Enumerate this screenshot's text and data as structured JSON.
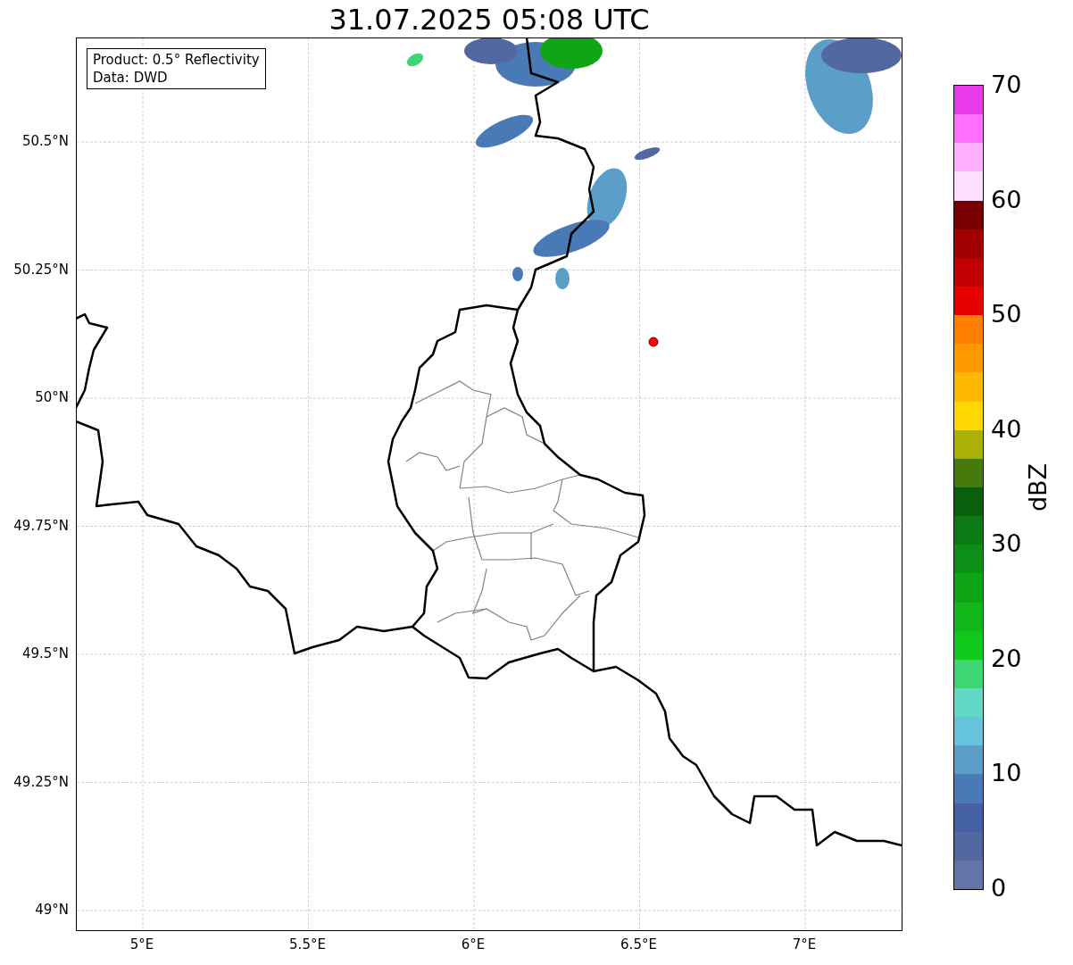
{
  "title": "31.07.2025 05:08 UTC",
  "info_box": {
    "lines": [
      "Product: 0.5° Reflectivity",
      "Data: DWD"
    ]
  },
  "map": {
    "yticks": [
      "50.5°N",
      "50.25°N",
      "50°N",
      "49.75°N",
      "49.5°N",
      "49.25°N",
      "49°N"
    ],
    "xticks": [
      "5°E",
      "5.5°E",
      "6°E",
      "6.5°E",
      "7°E"
    ]
  },
  "colorbar": {
    "label": "dBZ",
    "ticks": [
      "70",
      "60",
      "50",
      "40",
      "30",
      "20",
      "10",
      "0"
    ],
    "bins": [
      {
        "color": "#e83ae8"
      },
      {
        "color": "#ff70ff"
      },
      {
        "color": "#ffb0ff"
      },
      {
        "color": "#ffdfff"
      },
      {
        "color": "#7a0000"
      },
      {
        "color": "#a00000"
      },
      {
        "color": "#c00000"
      },
      {
        "color": "#e60000"
      },
      {
        "color": "#ff7f00"
      },
      {
        "color": "#ff9900"
      },
      {
        "color": "#ffb800"
      },
      {
        "color": "#ffd700"
      },
      {
        "color": "#aab005"
      },
      {
        "color": "#477a0c"
      },
      {
        "color": "#095f0c"
      },
      {
        "color": "#0b7a14"
      },
      {
        "color": "#0c8f17"
      },
      {
        "color": "#10a516"
      },
      {
        "color": "#12b81a"
      },
      {
        "color": "#10c81a"
      },
      {
        "color": "#3dd673"
      },
      {
        "color": "#62d8c6"
      },
      {
        "color": "#65c3dc"
      },
      {
        "color": "#5b9ec8"
      },
      {
        "color": "#4a7ab5"
      },
      {
        "color": "#4361a3"
      },
      {
        "color": "#5168a0"
      },
      {
        "color": "#6474a8"
      }
    ]
  }
}
